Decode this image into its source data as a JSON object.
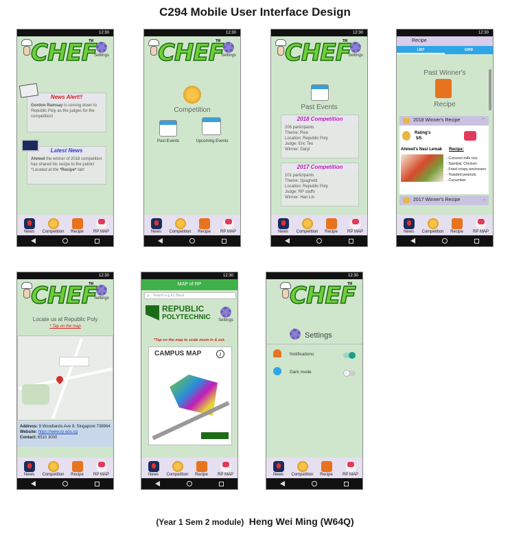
{
  "page_title": "C294 Mobile User Interface Design",
  "footer_module": "(Year 1 Sem 2 module)",
  "footer_author": "Heng Wei Ming (W64Q)",
  "status_time": "12:30",
  "logo_text": "CHEF",
  "logo_tm": "TM",
  "settings_label": "Settings",
  "tabs": {
    "news": "News",
    "competition": "Competition",
    "recipe": "Recipe",
    "map": "RP MAP"
  },
  "screen1": {
    "news_alert_title": "News Alert!!",
    "news_alert_name": "Gordon Ramsay",
    "news_alert_text": " is coming down to Republic Poly as the judges for the competition!",
    "latest_news_title": "Latest News",
    "latest_news_name": "Ahmed",
    "latest_news_text": " the winner of 2018 competition has shared his recipe to the public!",
    "latest_news_text2": "*Located at the ",
    "latest_news_tab": "*Recipe*",
    "latest_news_text3": " tab!"
  },
  "screen2": {
    "competition_label": "Competition",
    "past_events": "Past Events",
    "upcoming_events": "Upcoming Events"
  },
  "screen3": {
    "heading": "Past Events",
    "c2018_title": "2018 Competition",
    "c2018_lines": [
      "205 participants",
      "Theme: Rice",
      "Location: Republic Poly",
      "Judge: Eric Teo",
      "Winner: Daryl"
    ],
    "c2017_title": "2017 Competition",
    "c2017_lines": [
      "101 participants",
      "Theme: Spaghetti",
      "Location: Republic Poly",
      "Judge: RP staffs",
      "Winner: Han Lin"
    ]
  },
  "screen4": {
    "appbar_title": "Recipe",
    "seg_list": "LIST",
    "seg_grid": "GRID",
    "heading_line1": "Past Winner's",
    "heading_line2": "Recipe",
    "row_2018": "2018 Winner's Recipe",
    "rating_label": "Rating's",
    "rating_value": "5/5",
    "recipe_label": "Recipe:",
    "dish_name": "Ahmed's Nasi Lemak",
    "ingredients": [
      "- Coconut milk rice",
      "- Sambal, Chicken",
      "- Fried crispy anchovies",
      "- Toasted peanuts",
      "- Cucumber"
    ],
    "row_2017": "2017 Winner's Recipe"
  },
  "screen5": {
    "locate_text": "Locate us at Republic Poly",
    "tap_text": "* Tap on the map",
    "address_label": "Address:",
    "address_value": " 9 Woodlands Ave 9, Singapore 738964",
    "website_label": "Website:",
    "website_value": "https://www.rp.edu.sg",
    "contact_label": "Contact:",
    "contact_value": " 6510 3000"
  },
  "screen6": {
    "appbar_title": "MAP of RP",
    "search_placeholder": "Search e.g E1 Block",
    "rp_line1": "REPUBLIC",
    "rp_line2": "POLYTECHNIC",
    "hint": "*Tap on the map to scale zoom in & out.",
    "campus_title": "CAMPUS MAP"
  },
  "screen7": {
    "heading": "Settings",
    "notifications": "Notifications",
    "dark_mode": "Dark mode",
    "notifications_on": true,
    "dark_mode_on": false
  }
}
